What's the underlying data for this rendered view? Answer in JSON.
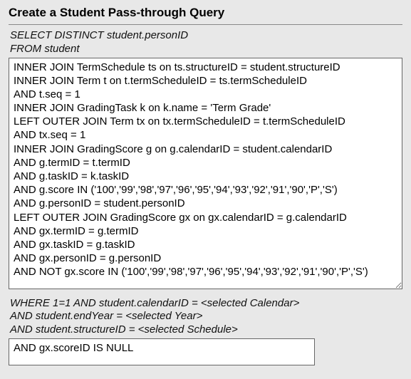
{
  "header": {
    "title": "Create a Student Pass-through Query"
  },
  "block1": {
    "pretext": "SELECT DISTINCT student.personID\nFROM student",
    "textarea_value": "INNER JOIN TermSchedule ts on ts.structureID = student.structureID\nINNER JOIN Term t on t.termScheduleID = ts.termScheduleID\nAND t.seq = 1\nINNER JOIN GradingTask k on k.name = 'Term Grade'\nLEFT OUTER JOIN Term tx on tx.termScheduleID = t.termScheduleID\nAND tx.seq = 1\nINNER JOIN GradingScore g on g.calendarID = student.calendarID\nAND g.termID = t.termID\nAND g.taskID = k.taskID\nAND g.score IN ('100','99','98','97','96','95','94','93','92','91','90','P','S')\nAND g.personID = student.personID\nLEFT OUTER JOIN GradingScore gx on gx.calendarID = g.calendarID\nAND gx.termID = g.termID\nAND gx.taskID = g.taskID\nAND gx.personID = g.personID\nAND NOT gx.score IN ('100','99','98','97','96','95','94','93','92','91','90','P','S')"
  },
  "block2": {
    "pretext": "WHERE 1=1 AND student.calendarID = <selected Calendar>\nAND student.endYear = <selected Year>\nAND student.structureID = <selected Schedule>",
    "textarea_value": "AND gx.scoreID IS NULL"
  }
}
